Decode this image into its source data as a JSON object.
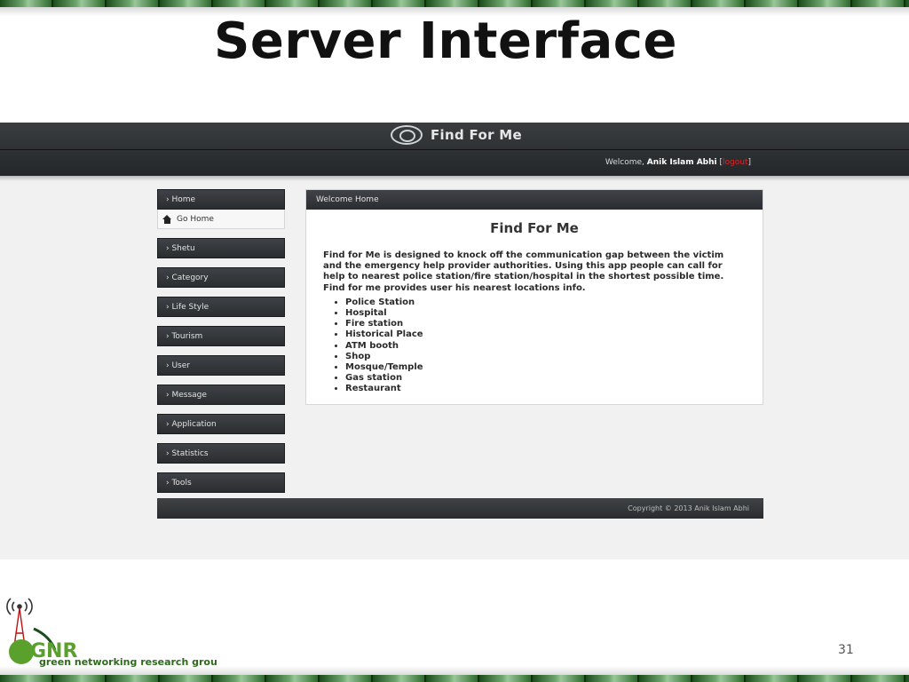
{
  "slide": {
    "title": "Server Interface",
    "page_number": "31",
    "brand": {
      "logo_letters": "GNR",
      "group_name": "green networking research group",
      "colors": {
        "green": "#5aa02c",
        "dark": "#1b4d1b"
      }
    }
  },
  "app": {
    "name": "Find For Me",
    "welcome": {
      "prefix": "Welcome,",
      "user": "Anik Islam Abhi",
      "open_bracket": "[",
      "logout": "logout",
      "close_bracket": "]"
    },
    "sidebar": {
      "home": "› Home",
      "go_home": "Go Home",
      "items": [
        "› Shetu",
        "› Category",
        "› Life Style",
        "› Tourism",
        "› User",
        "› Message",
        "› Application",
        "› Statistics",
        "› Tools"
      ]
    },
    "panel": {
      "header": "Welcome Home",
      "title": "Find For Me",
      "description": "Find for Me is designed to knock off the communication gap between the victim and the emergency help provider authorities. Using this app people can call for help to nearest police station/fire station/hospital in the shortest possible time. Find for me provides user his nearest locations info.",
      "list": [
        "Police Station",
        "Hospital",
        "Fire station",
        "Historical Place",
        "ATM booth",
        "Shop",
        "Mosque/Temple",
        "Gas station",
        "Restaurant"
      ]
    },
    "footer": "Copyright © 2013 Anik Islam Abhi",
    "colors": {
      "header": "#2a2d30",
      "logout": "#e02020",
      "background": "#f1f1f1"
    }
  }
}
